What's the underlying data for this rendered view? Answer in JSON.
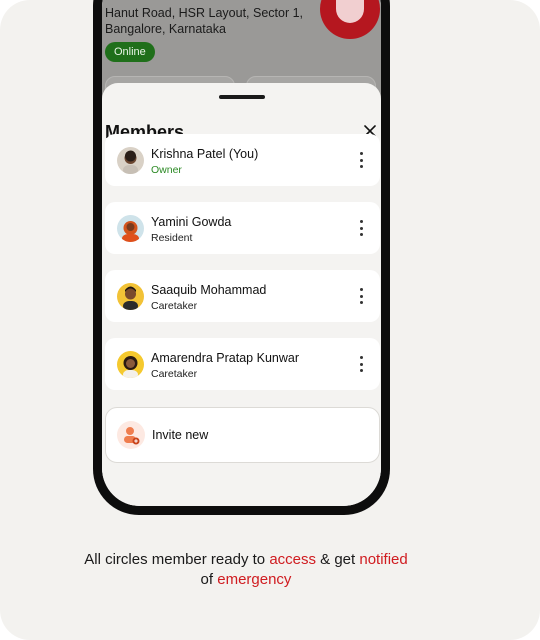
{
  "header_card": {
    "address_line1": "Hanut Road, HSR Layout, Sector 1,",
    "address_line2": "Bangalore, Karnataka",
    "status": "Online"
  },
  "sheet": {
    "title": "Members",
    "close_icon": "close-icon",
    "members": [
      {
        "name": "Krishna Patel (You)",
        "role": "Owner"
      },
      {
        "name": "Yamini Gowda",
        "role": "Resident"
      },
      {
        "name": "Saaquib Mohammad",
        "role": "Caretaker"
      },
      {
        "name": "Amarendra Pratap Kunwar",
        "role": "Caretaker"
      }
    ],
    "invite_label": "Invite new",
    "more_icon": "more-vertical-icon"
  },
  "caption": {
    "part1": "All circles member ready to ",
    "highlight1": "access",
    "part2": " & get ",
    "highlight2": "notified",
    "part3": "of ",
    "highlight3": "emergency"
  },
  "colors": {
    "accent_red": "#d01c20",
    "owner_green": "#2c8a25",
    "online_pill": "#1f6f1a",
    "background": "#f3f2ef"
  }
}
